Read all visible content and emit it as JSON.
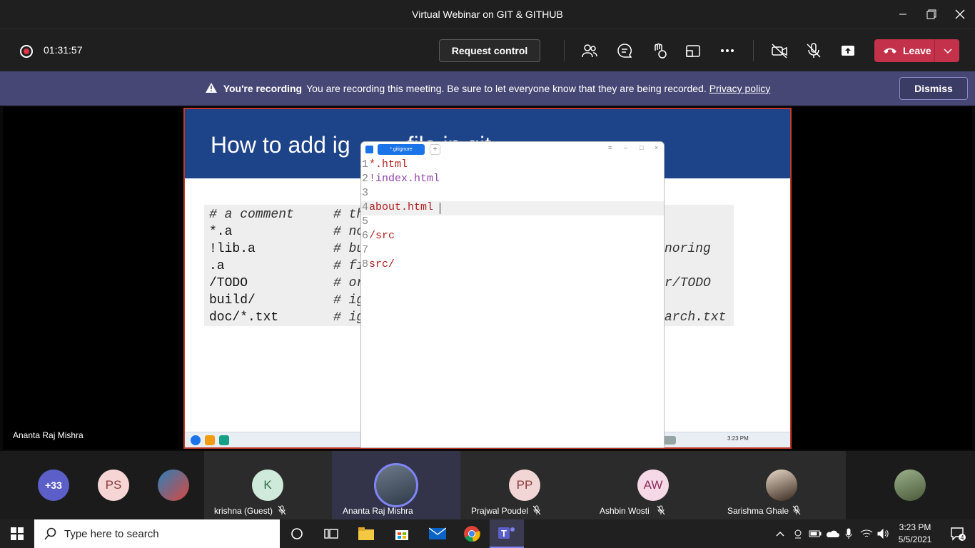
{
  "window": {
    "title": "Virtual Webinar on GIT & GITHUB"
  },
  "toolbar": {
    "timer": "01:31:57",
    "request_control": "Request control",
    "leave": "Leave"
  },
  "banner": {
    "bold": "You're recording",
    "text": "You are recording this meeting. Be sure to let everyone know that they are being recorded.",
    "link": "Privacy policy",
    "dismiss": "Dismiss"
  },
  "presenter_name": "Ananta Raj Mishra",
  "slide": {
    "title": "How to add ig",
    "title_tail": "file in git",
    "rows": [
      {
        "code": "# a comment",
        "comment": "# th"
      },
      {
        "code": "*.a",
        "comment": "# no"
      },
      {
        "code": "!lib.a",
        "comment": "# bu",
        "tail": "noring"
      },
      {
        "code": ".a",
        "comment": "# fi"
      },
      {
        "code": "/TODO",
        "comment": "# or",
        "tail": "r/TODO"
      },
      {
        "code": "build/",
        "comment": "# ig"
      },
      {
        "code": "doc/*.txt",
        "comment": "# ig",
        "tail": "arch.txt"
      }
    ],
    "inner_clock": "3:23 PM"
  },
  "editor": {
    "tab": "*.gitignore",
    "lines": [
      {
        "n": "1",
        "text": "*.html"
      },
      {
        "n": "2",
        "text": "!index.html"
      },
      {
        "n": "3",
        "text": ""
      },
      {
        "n": "4",
        "text": "about.html"
      },
      {
        "n": "5",
        "text": ""
      },
      {
        "n": "6",
        "text": "/src"
      },
      {
        "n": "7",
        "text": ""
      },
      {
        "n": "8",
        "text": "src/"
      }
    ]
  },
  "participants": {
    "overflow": "+33",
    "ps": "PS",
    "tiles": [
      {
        "initials": "K",
        "name": "krishna (Guest)"
      },
      {
        "initials": "",
        "name": "Ananta Raj Mishra"
      },
      {
        "initials": "PP",
        "name": "Prajwal Poudel"
      },
      {
        "initials": "AW",
        "name": "Ashbin Wosti"
      },
      {
        "initials": "",
        "name": "Sarishma Ghale"
      }
    ]
  },
  "taskbar": {
    "search_placeholder": "Type here to search",
    "time": "3:23 PM",
    "date": "5/5/2021",
    "notifications": "4"
  },
  "colors": {
    "leave": "#c4314b",
    "banner": "#464775",
    "slide_header": "#1d4388",
    "code_red": "#b22222"
  }
}
